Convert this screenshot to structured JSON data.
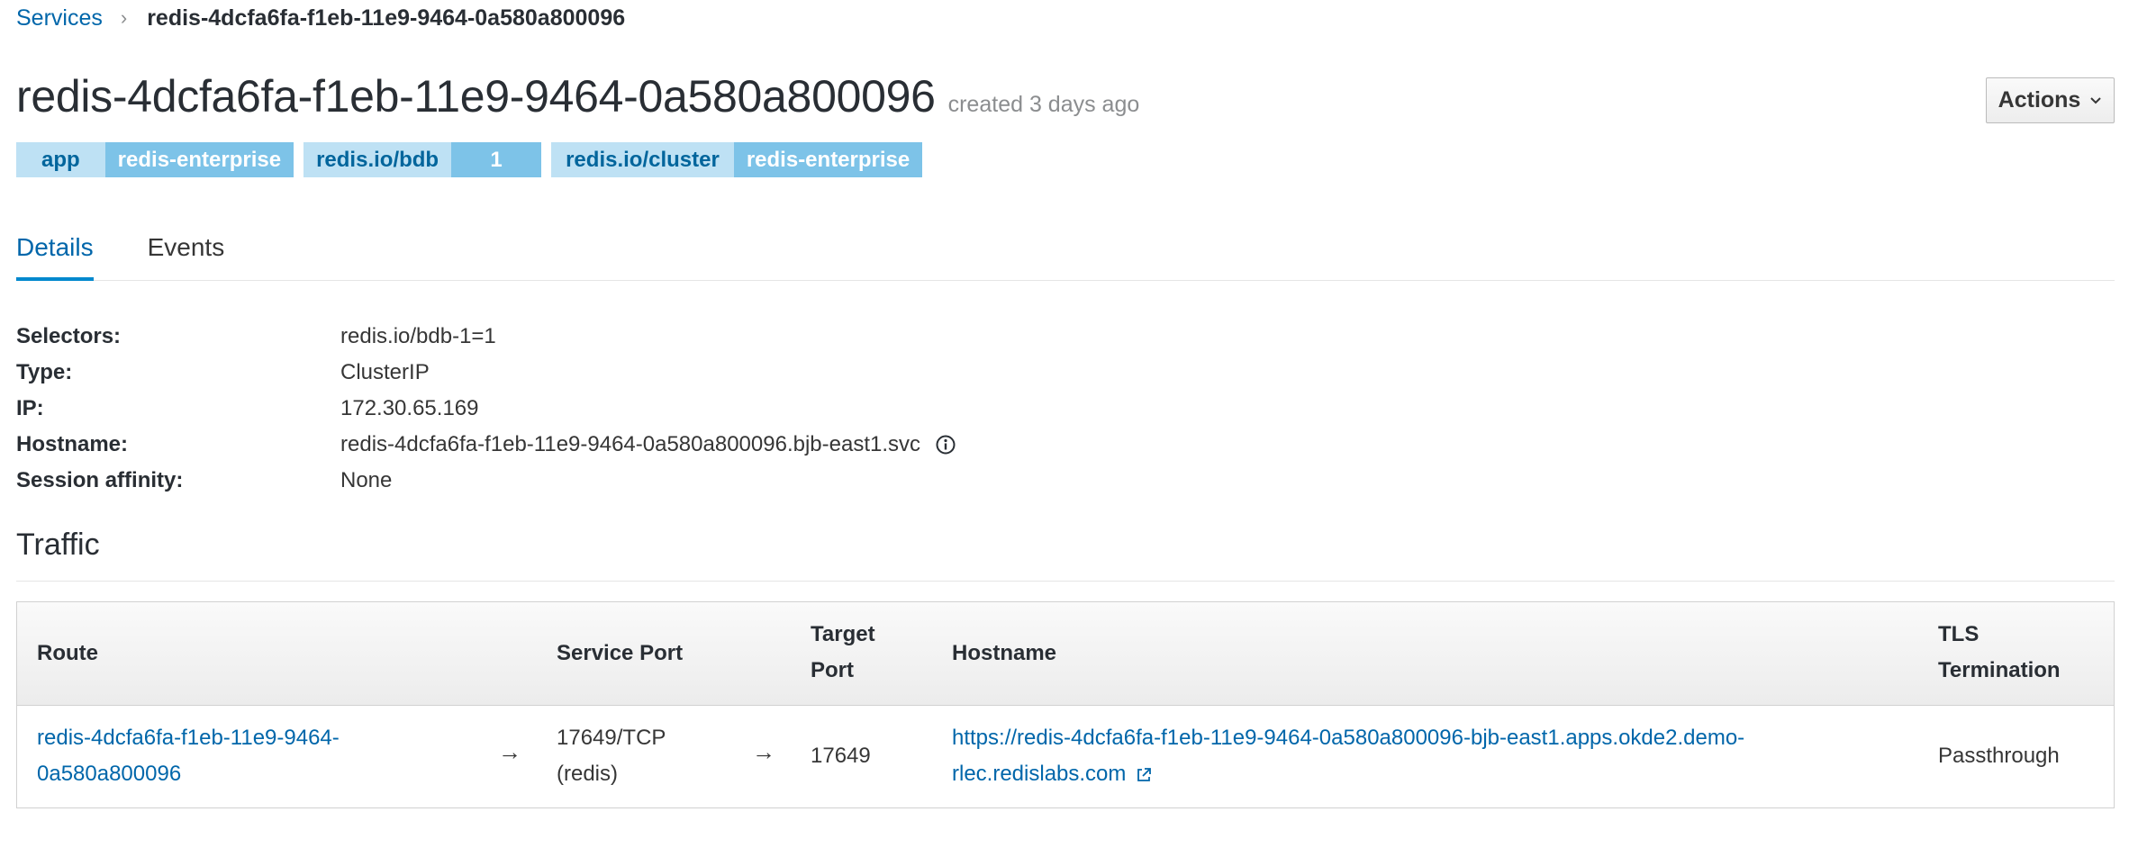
{
  "breadcrumb": {
    "parent": "Services",
    "separator": "›",
    "current": "redis-4dcfa6fa-f1eb-11e9-9464-0a580a800096"
  },
  "header": {
    "title": "redis-4dcfa6fa-f1eb-11e9-9464-0a580a800096",
    "created": "created 3 days ago",
    "actions_label": "Actions",
    "actions_icon": "chevron-down-icon"
  },
  "labels": [
    {
      "key": "app",
      "value": "redis-enterprise"
    },
    {
      "key": "redis.io/bdb",
      "value": "1"
    },
    {
      "key": "redis.io/cluster",
      "value": "redis-enterprise"
    }
  ],
  "tabs": [
    {
      "label": "Details",
      "active": true
    },
    {
      "label": "Events",
      "active": false
    }
  ],
  "details": [
    {
      "key": "Selectors:",
      "value": "redis.io/bdb-1=1"
    },
    {
      "key": "Type:",
      "value": "ClusterIP"
    },
    {
      "key": "IP:",
      "value": "172.30.65.169"
    },
    {
      "key": "Hostname:",
      "value": "redis-4dcfa6fa-f1eb-11e9-9464-0a580a800096.bjb-east1.svc"
    },
    {
      "key": "Session affinity:",
      "value": "None"
    }
  ],
  "traffic": {
    "title": "Traffic",
    "columns": {
      "route": "Route",
      "service_port": "Service Port",
      "target_port_1": "Target",
      "target_port_2": "Port",
      "hostname": "Hostname",
      "tls_1": "TLS",
      "tls_2": "Termination"
    },
    "row": {
      "route_1": "redis-4dcfa6fa-f1eb-11e9-9464-",
      "route_2": "0a580a800096",
      "arrow": "→",
      "service_port_1": "17649/TCP",
      "service_port_2": "(redis)",
      "target_port": "17649",
      "hostname_1": "https://redis-4dcfa6fa-f1eb-11e9-9464-0a580a800096-bjb-east1.apps.okde2.demo-",
      "hostname_2": "rlec.redislabs.com",
      "tls": "Passthrough"
    }
  },
  "colors": {
    "link": "#0066aa",
    "label_key_bg": "#bee1f4",
    "label_value_bg": "#7dc3e8",
    "tab_active": "#0088ce"
  }
}
